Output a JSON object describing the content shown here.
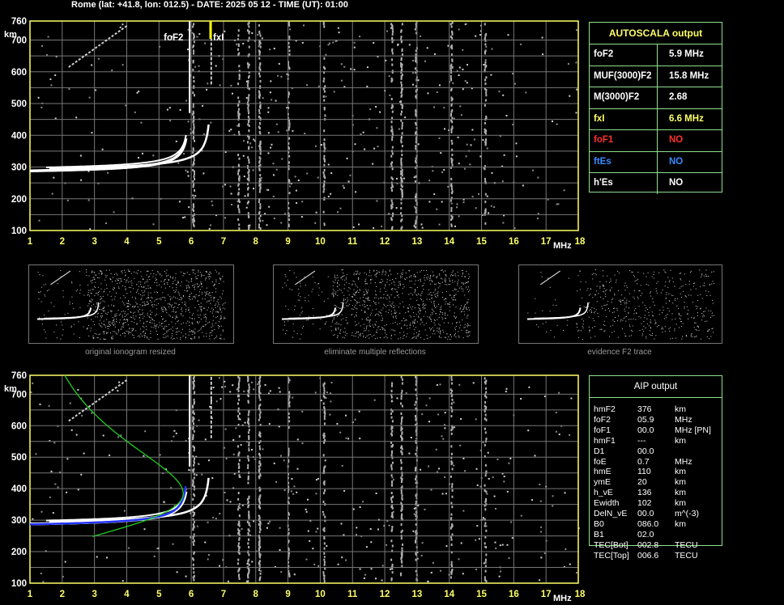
{
  "header": {
    "title": "Rome (lat: +41.8, lon: 012.5) - DATE: 2025 05 12 - TIME (UT): 01:00"
  },
  "ionogram_top": {
    "y_unit": "km",
    "x_unit": "MHz",
    "y_ticks": [
      "760",
      "700",
      "600",
      "500",
      "400",
      "300",
      "200",
      "100"
    ],
    "x_ticks": [
      "1",
      "2",
      "3",
      "4",
      "5",
      "6",
      "7",
      "8",
      "9",
      "10",
      "11",
      "12",
      "13",
      "14",
      "15",
      "16",
      "17",
      "18"
    ],
    "label_foF2": "foF2",
    "label_fxI": "fxI"
  },
  "ionogram_bottom": {
    "y_unit": "km",
    "x_unit": "MHz",
    "y_ticks": [
      "760",
      "700",
      "600",
      "500",
      "400",
      "300",
      "200",
      "100"
    ],
    "x_ticks": [
      "1",
      "2",
      "3",
      "4",
      "5",
      "6",
      "7",
      "8",
      "9",
      "10",
      "11",
      "12",
      "13",
      "14",
      "15",
      "16",
      "17",
      "18"
    ]
  },
  "autoscala": {
    "title": "AUTOSCALA output",
    "rows": [
      {
        "key": "foF2",
        "value": "5.9 MHz",
        "color": "#ffffff"
      },
      {
        "key": "MUF(3000)F2",
        "value": "15.8 MHz",
        "color": "#ffffff"
      },
      {
        "key": "M(3000)F2",
        "value": "2.68",
        "color": "#ffffff"
      },
      {
        "key": "fxI",
        "value": "6.6 MHz",
        "color": "#ffff66"
      },
      {
        "key": "foF1",
        "value": "NO",
        "color": "#ff3030"
      },
      {
        "key": "ftEs",
        "value": "NO",
        "color": "#3a8bff"
      },
      {
        "key": "h'Es",
        "value": "NO",
        "color": "#ffffff"
      }
    ]
  },
  "thumbnails": [
    {
      "caption": "original ionogram resized"
    },
    {
      "caption": "eliminate multiple reflections"
    },
    {
      "caption": "evidence F2 trace"
    }
  ],
  "aip": {
    "title": "AIP output",
    "rows": [
      {
        "name": "hmF2",
        "value": "376",
        "unit": "km"
      },
      {
        "name": "foF2",
        "value": "05.9",
        "unit": "MHz"
      },
      {
        "name": "foF1",
        "value": "00.0",
        "unit": "MHz    [PN]"
      },
      {
        "name": "hmF1",
        "value": "---",
        "unit": "km"
      },
      {
        "name": "D1",
        "value": "00.0",
        "unit": ""
      },
      {
        "name": "foE",
        "value": "0.7",
        "unit": "MHz"
      },
      {
        "name": "hmE",
        "value": "110",
        "unit": "km"
      },
      {
        "name": "ymE",
        "value": "20",
        "unit": "km"
      },
      {
        "name": "h_vE",
        "value": "136",
        "unit": "km"
      },
      {
        "name": "Ewidth",
        "value": "102",
        "unit": "km"
      },
      {
        "name": "DelN_vE",
        "value": "00.0",
        "unit": "m^(-3)"
      },
      {
        "name": "B0",
        "value": "086.0",
        "unit": "km"
      },
      {
        "name": "B1",
        "value": "02.0",
        "unit": ""
      },
      {
        "name": "TEC[Bot]",
        "value": "002.8",
        "unit": "TECU"
      },
      {
        "name": "TEC[Top]",
        "value": "006.6",
        "unit": "TECU"
      }
    ]
  },
  "colors": {
    "axis": "#ffff66",
    "grid": "#777777",
    "panel_border": "#8fe08f",
    "profile_blue": "#2233ff",
    "profile_green": "#22cc22",
    "fxI_marker": "#ffff00"
  }
}
